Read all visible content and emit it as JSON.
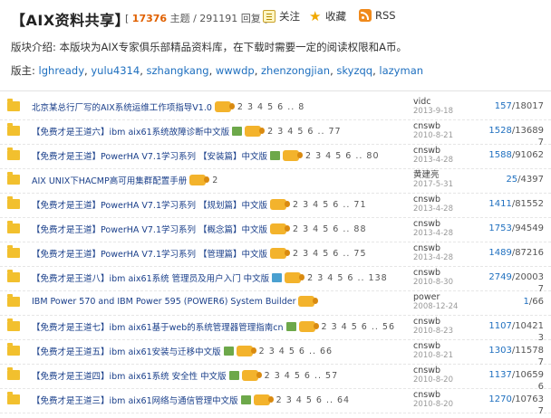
{
  "header": {
    "title": "【AIX资料共享】",
    "stats_open": "[ ",
    "topics_count": "17376",
    "topics_label": " 主题 / ",
    "replies_count": "291191",
    "replies_label": " 回复 ]",
    "follow_label": "关注",
    "favorite_label": "收藏",
    "rss_label": "RSS"
  },
  "intro": "版块介绍: 本版块为AIX专家俱乐部精品资料库，在下载时需要一定的阅读权限和A币。",
  "moderators": {
    "label": "版主: ",
    "names": [
      "lghready",
      "yulu4314",
      "szhangkang",
      "wwwdp",
      "zhenzongjian",
      "skyzqq",
      "lazyman"
    ],
    "sep": ", "
  },
  "threads": [
    {
      "title": "北京某总行厂写的AIX系统运维工作项指导V1.0",
      "badge": "",
      "pages": "2 3 4 5 6 .. 8",
      "author": "vidc",
      "date": "2013-9-18",
      "replies": "157",
      "views": "18017",
      "wrap": ""
    },
    {
      "title": "【免费才是王道六】ibm aix61系统故障诊断中文版",
      "badge": "g",
      "pages": "2 3 4 5 6 .. 77",
      "author": "cnswb",
      "date": "2010-8-21",
      "replies": "1528",
      "views": "13689",
      "wrap": "7"
    },
    {
      "title": "【免费才是王道】PowerHA V7.1学习系列 【安装篇】中文版",
      "badge": "g",
      "pages": "2 3 4 5 6 .. 80",
      "author": "cnswb",
      "date": "2013-4-28",
      "replies": "1588",
      "views": "91062",
      "wrap": ""
    },
    {
      "title": "AIX UNIX下HACMP高可用集群配置手册",
      "badge": "",
      "pages": "2",
      "author": "黄建亮",
      "date": "2017-5-31",
      "replies": "25",
      "views": "4397",
      "wrap": ""
    },
    {
      "title": "【免费才是王道】PowerHA V7.1学习系列 【规划篇】中文版",
      "badge": "",
      "pages": "2 3 4 5 6 .. 71",
      "author": "cnswb",
      "date": "2013-4-28",
      "replies": "1411",
      "views": "81552",
      "wrap": ""
    },
    {
      "title": "【免费才是王道】PowerHA V7.1学习系列 【概念篇】中文版",
      "badge": "",
      "pages": "2 3 4 5 6 .. 88",
      "author": "cnswb",
      "date": "2013-4-28",
      "replies": "1753",
      "views": "94549",
      "wrap": ""
    },
    {
      "title": "【免费才是王道】PowerHA V7.1学习系列 【管理篇】中文版",
      "badge": "",
      "pages": "2 3 4 5 6 .. 75",
      "author": "cnswb",
      "date": "2013-4-28",
      "replies": "1489",
      "views": "87216",
      "wrap": ""
    },
    {
      "title": "【免费才是王道八】ibm aix61系统 管理员及用户入门 中文版",
      "badge": "m",
      "pages": "2 3 4 5 6 .. 138",
      "author": "cnswb",
      "date": "2010-8-30",
      "replies": "2749",
      "views": "20003",
      "wrap": "7"
    },
    {
      "title": "IBM Power 570 and IBM Power 595 (POWER6) System Builder",
      "badge": "",
      "pages": "",
      "author": "power",
      "date": "2008-12-24",
      "replies": "1",
      "views": "66",
      "wrap": ""
    },
    {
      "title": "【免费才是王道七】ibm aix61基于web的系统管理器管理指南cn",
      "badge": "g",
      "pages": "2 3 4 5 6 .. 56",
      "author": "cnswb",
      "date": "2010-8-23",
      "replies": "1107",
      "views": "10421",
      "wrap": "3"
    },
    {
      "title": "【免费才是王道五】ibm aix61安装与迁移中文版",
      "badge": "g",
      "pages": "2 3 4 5 6 .. 66",
      "author": "cnswb",
      "date": "2010-8-21",
      "replies": "1303",
      "views": "11578",
      "wrap": "7"
    },
    {
      "title": "【免费才是王道四】ibm aix61系统 安全性 中文版",
      "badge": "g",
      "pages": "2 3 4 5 6 .. 57",
      "author": "cnswb",
      "date": "2010-8-20",
      "replies": "1137",
      "views": "10659",
      "wrap": "6"
    },
    {
      "title": "【免费才是王道三】ibm aix61网络与通信管理中文版",
      "badge": "g",
      "pages": "2 3 4 5 6 .. 64",
      "author": "cnswb",
      "date": "2010-8-20",
      "replies": "1270",
      "views": "10763",
      "wrap": "7"
    }
  ],
  "colors": {
    "accent": "#e06000",
    "link": "#1e6fbf",
    "folder": "#f2c02e"
  }
}
